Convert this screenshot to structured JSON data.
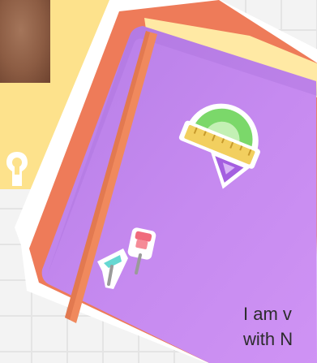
{
  "caption": {
    "line1": "I am v",
    "line2": "with N"
  },
  "notebook": {
    "cover_color": "#c587ea",
    "spine_color": "#ef7d5a",
    "strap_color": "#f08a5d",
    "stickers": [
      "ruler-protractor-sticker-icon",
      "pushpin-sticker-icon"
    ]
  },
  "colors": {
    "sticky_note": "#fde28c",
    "background": "#f3f3f3",
    "grid": "#e4e4e4"
  }
}
